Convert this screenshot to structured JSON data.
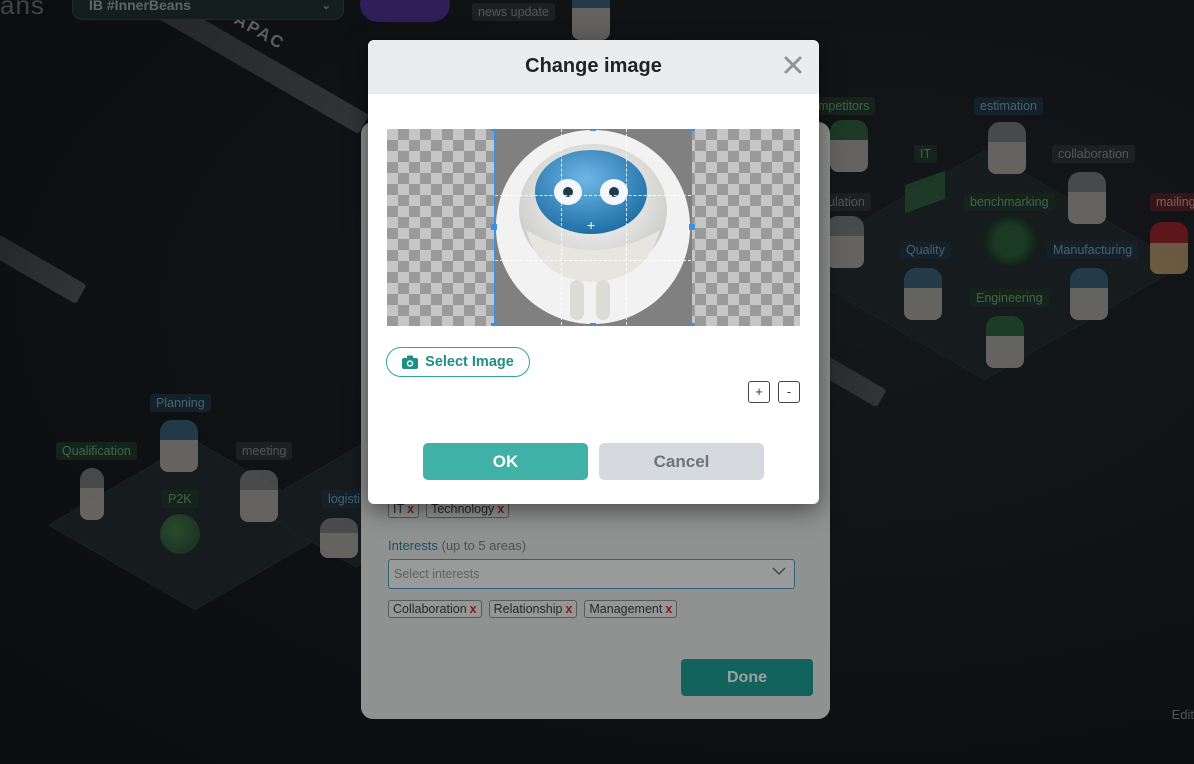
{
  "header": {
    "brand": "ans",
    "space_selector": "IB #InnerBeans"
  },
  "world": {
    "region_label": "APAC",
    "edit_link": "Edit",
    "tags": {
      "news_update": "news update",
      "competitors": "mpetitors",
      "estimation": "estimation",
      "it": "IT",
      "collaboration": "collaboration",
      "regulation": "ulation",
      "benchmarking": "benchmarking",
      "mailing": "mailing",
      "quality": "Quality",
      "manufacturing": "Manufacturing",
      "engineering": "Engineering",
      "planning": "Planning",
      "qualification": "Qualification",
      "meeting": "meeting",
      "p2k": "P2K",
      "logistics": "logisti"
    }
  },
  "profile": {
    "skill_chips": [
      "IT",
      "Technology"
    ],
    "interests_label": "Interests",
    "interests_hint": "(up to 5 areas)",
    "interests_placeholder": "Select interests",
    "interest_chips": [
      "Collaboration",
      "Relationship",
      "Management"
    ],
    "chip_remove": "x",
    "done_label": "Done"
  },
  "modal": {
    "title": "Change image",
    "close_symbol": "✕",
    "select_image_label": "Select Image",
    "zoom_in": "+",
    "zoom_out": "-",
    "ok_label": "OK",
    "cancel_label": "Cancel",
    "crop_center_mark": "+"
  },
  "colors": {
    "accent": "#3fb1a6",
    "crop_border": "#3d8fe0",
    "remove_x": "#d0342c"
  }
}
